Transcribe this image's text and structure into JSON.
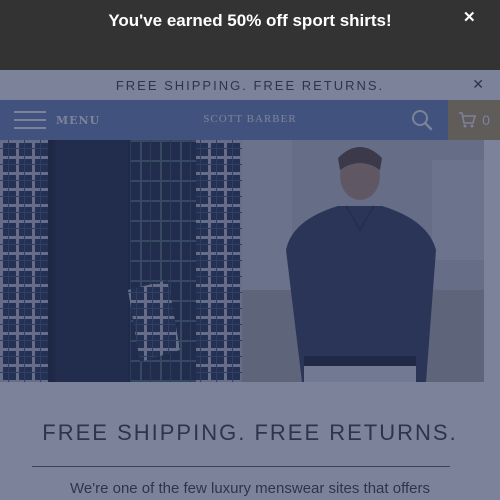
{
  "notification": {
    "message": "You've earned 50% off sport shirts!",
    "close_glyph": "✕"
  },
  "promo_bar": {
    "text": "FREE SHIPPING. FREE RETURNS.",
    "close_glyph": "✕"
  },
  "header": {
    "menu_label": "MENU",
    "logo_text": "SCOTT BARBER",
    "cart_count": "0",
    "icons": [
      "menu-icon",
      "search-icon",
      "cart-icon"
    ]
  },
  "section": {
    "heading": "FREE SHIPPING. FREE RETURNS.",
    "body": "We're one of the few luxury menswear sites that offers"
  },
  "colors": {
    "notice_bg": "#333333",
    "overlay": "rgba(42,54,92,0.62)",
    "header_bg": "#6b80b8",
    "cart_bg": "#b89b57"
  }
}
